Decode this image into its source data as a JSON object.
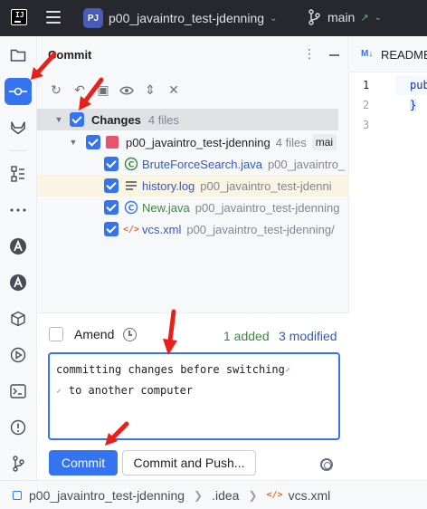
{
  "titlebar": {
    "logo_text": "IJ",
    "project_badge": "PJ",
    "project_name": "p00_javaintro_test-jdenning",
    "branch": "main"
  },
  "panel": {
    "title": "Commit",
    "changes_label": "Changes",
    "changes_count": "4 files",
    "module_name": "p00_javaintro_test-jdenning",
    "module_count": "4 files",
    "module_branch": "mai",
    "files": [
      {
        "name": "BruteForceSearch.java",
        "path": "p00_javaintro_",
        "icon": "java-class-modified-icon"
      },
      {
        "name": "history.log",
        "path": "p00_javaintro_test-jdenni",
        "icon": "text-file-icon"
      },
      {
        "name": "New.java",
        "path": "p00_javaintro_test-jdenning",
        "icon": "java-class-added-icon"
      },
      {
        "name": "vcs.xml",
        "path": "p00_javaintro_test-jdenning/",
        "icon": "xml-file-icon"
      }
    ]
  },
  "commit": {
    "amend_label": "Amend",
    "added": "1 added",
    "modified": "3 modified",
    "message_line1": "committing changes before switching",
    "message_line2": "to another computer",
    "commit_button": "Commit",
    "commit_push_button": "Commit and Push..."
  },
  "editor": {
    "tab": "README",
    "tab_icon": "M↓",
    "lines": [
      "1",
      "2",
      "3"
    ],
    "code_line1": "pub",
    "code_line2": "}"
  },
  "statusbar": {
    "project": "p00_javaintro_test-jdenning",
    "folder": ".idea",
    "file": "vcs.xml"
  },
  "colors": {
    "accent": "#3574f0",
    "annotation": "#e8201a",
    "added": "#3a8a3e"
  }
}
